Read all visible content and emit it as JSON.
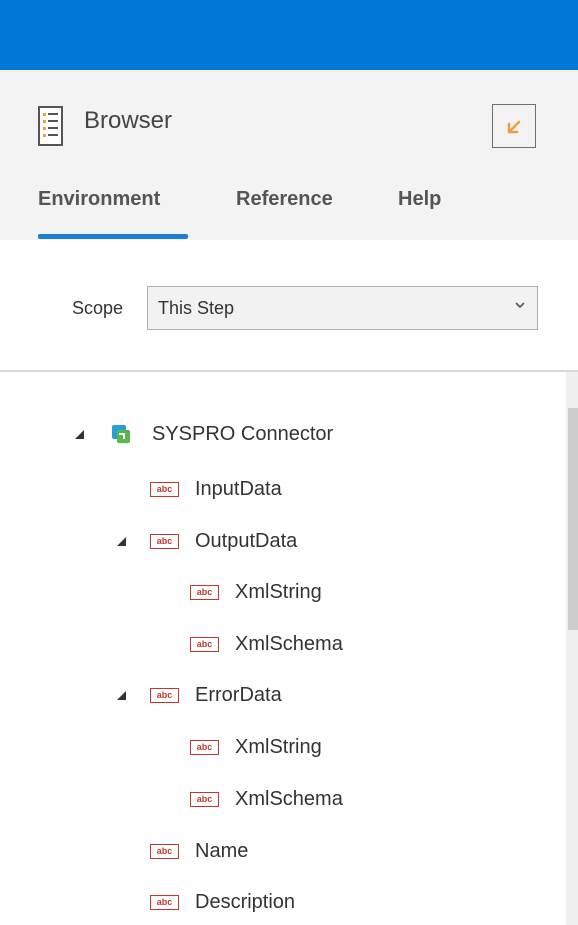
{
  "header": {
    "title": "Browser",
    "icons": {
      "app": "list-document-icon",
      "dock": "dock-arrow-icon"
    },
    "tabs": [
      {
        "label": "Environment",
        "active": true
      },
      {
        "label": "Reference",
        "active": false
      },
      {
        "label": "Help",
        "active": false
      }
    ]
  },
  "scope": {
    "label": "Scope",
    "value": "This Step"
  },
  "tree": {
    "root": {
      "label": "SYSPRO Connector",
      "icon": "connector-icon",
      "expanded": true
    },
    "nodes": [
      {
        "label": "InputData",
        "icon": "abc-icon",
        "expanded": null
      },
      {
        "label": "OutputData",
        "icon": "abc-icon",
        "expanded": true
      },
      {
        "label": "XmlString",
        "icon": "abc-icon",
        "expanded": null
      },
      {
        "label": "XmlSchema",
        "icon": "abc-icon",
        "expanded": null
      },
      {
        "label": "ErrorData",
        "icon": "abc-icon",
        "expanded": true
      },
      {
        "label": "XmlString",
        "icon": "abc-icon",
        "expanded": null
      },
      {
        "label": "XmlSchema",
        "icon": "abc-icon",
        "expanded": null
      },
      {
        "label": "Name",
        "icon": "abc-icon",
        "expanded": null
      },
      {
        "label": "Description",
        "icon": "abc-icon",
        "expanded": null
      }
    ],
    "abc_icon_text": "abc"
  },
  "colors": {
    "topbar": "#0078d7",
    "header_bg": "#f3f3f3",
    "tab_underline": "#1c7ed6",
    "abc_icon": "#c0392b"
  }
}
